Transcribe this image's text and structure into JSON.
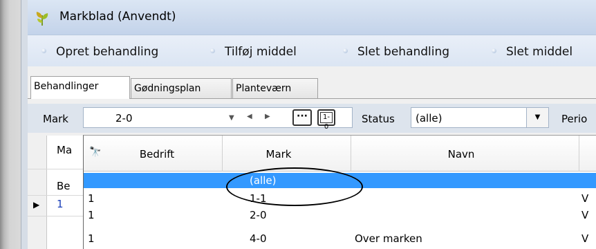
{
  "window": {
    "title": "Markblad (Anvendt)"
  },
  "actions": [
    {
      "label": "Opret behandling"
    },
    {
      "label": "Tilføj middel"
    },
    {
      "label": "Slet behandling"
    },
    {
      "label": "Slet middel"
    }
  ],
  "tabs": [
    {
      "label": "Behandlinger",
      "active": true
    },
    {
      "label": "Gødningsplan",
      "active": false
    },
    {
      "label": "Planteværn",
      "active": false
    }
  ],
  "toolbar": {
    "mark_label": "Mark",
    "mark_value": "2-0",
    "more_label": "···",
    "toggle_label": "1-0",
    "status_label": "Status",
    "status_value": "(alle)",
    "period_label": "Perio"
  },
  "grid": {
    "header_partial": "Ma",
    "row_partial_label": "Be",
    "current_row_value": "1"
  },
  "dropdown": {
    "columns": [
      "Bedrift",
      "Mark",
      "Navn"
    ],
    "rows": [
      {
        "bedrift": "",
        "mark": "(alle)",
        "navn": "",
        "extra": "",
        "selected": true
      },
      {
        "bedrift": "1",
        "mark": "1-1",
        "navn": "",
        "extra": "V",
        "selected": false
      },
      {
        "bedrift": "1",
        "mark": "2-0",
        "navn": "",
        "extra": "V",
        "selected": false
      },
      {
        "bedrift": "1",
        "mark": "4-0",
        "navn": "Over marken",
        "extra": "V",
        "selected": false
      }
    ]
  },
  "colors": {
    "selection": "#3399ff",
    "titlebar": "#cfdcee",
    "toolbar": "#dde4ed"
  }
}
